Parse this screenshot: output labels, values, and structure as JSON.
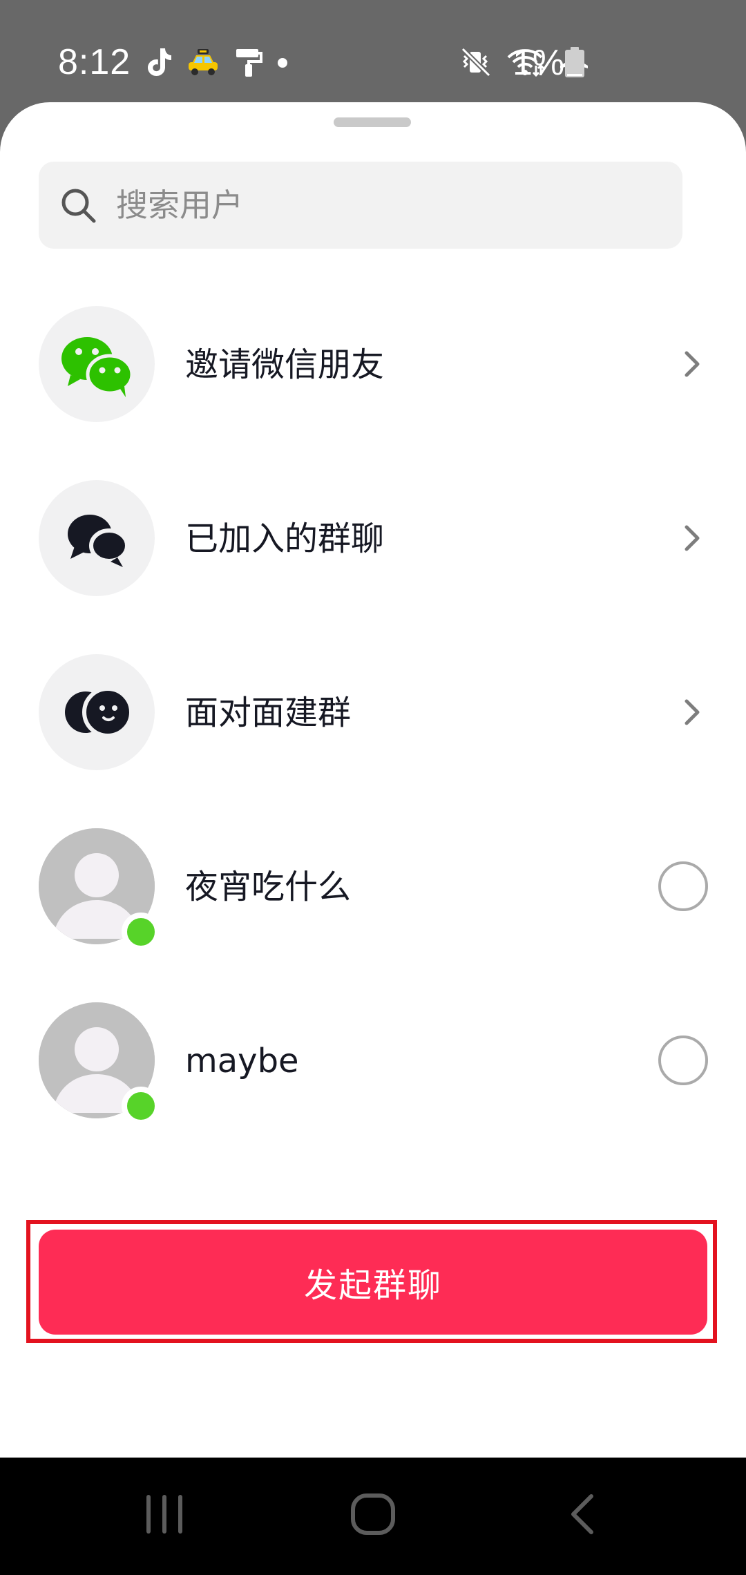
{
  "status_bar": {
    "time": "8:12",
    "battery": "1%",
    "left_icons": [
      "tiktok-icon",
      "taxi-icon",
      "paint-roller-icon",
      "dot-icon"
    ],
    "right_icons": [
      "vibrate-off-icon",
      "wifi-icon",
      "airplane-icon",
      "battery-icon"
    ]
  },
  "search": {
    "placeholder": "搜索用户",
    "value": ""
  },
  "menu": [
    {
      "label": "邀请微信朋友",
      "icon": "wechat-icon"
    },
    {
      "label": "已加入的群聊",
      "icon": "group-chat-icon"
    },
    {
      "label": "面对面建群",
      "icon": "face-to-face-icon"
    }
  ],
  "contacts": [
    {
      "name": "夜宵吃什么",
      "online": true,
      "selected": false
    },
    {
      "name": "maybe",
      "online": true,
      "selected": false
    }
  ],
  "actions": {
    "start_group_chat": "发起群聊"
  },
  "colors": {
    "accent": "#fe2c55",
    "online": "#57d329",
    "wechat_green": "#2dc100",
    "highlight_frame": "#e3121f"
  },
  "nav_bar": [
    "recent-apps-icon",
    "home-icon",
    "back-icon"
  ]
}
